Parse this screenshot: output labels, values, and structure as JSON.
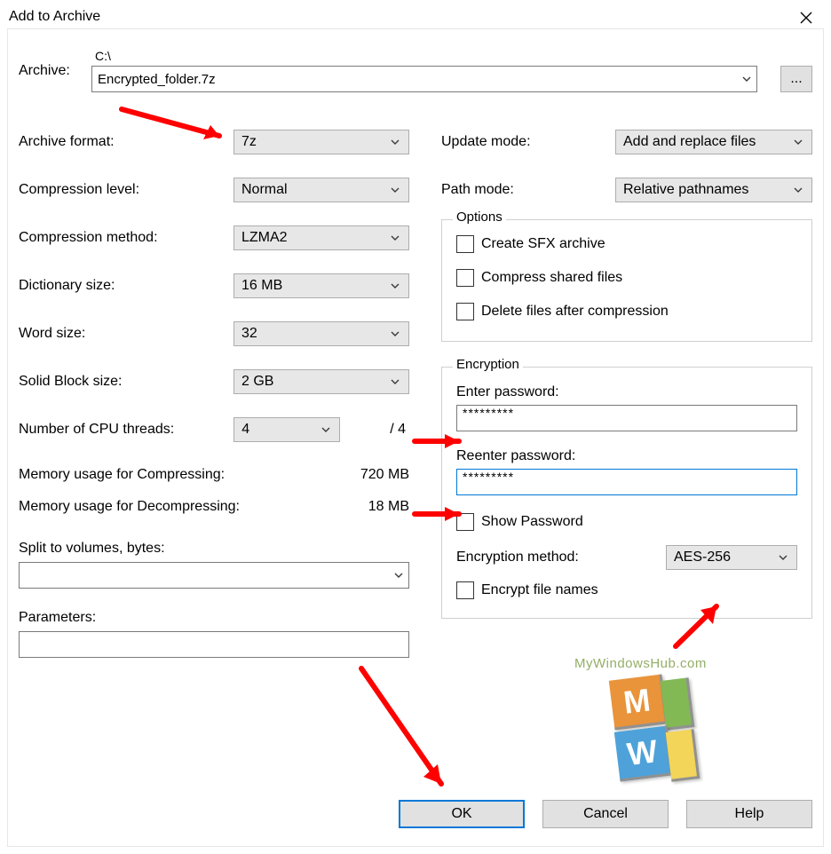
{
  "window": {
    "title": "Add to Archive"
  },
  "archive": {
    "label": "Archive:",
    "path": "C:\\",
    "filename": "Encrypted_folder.7z",
    "browse_label": "..."
  },
  "left": {
    "format_label": "Archive format:",
    "format_value": "7z",
    "level_label": "Compression level:",
    "level_value": "Normal",
    "method_label": "Compression method:",
    "method_value": "LZMA2",
    "dict_label": "Dictionary size:",
    "dict_value": "16 MB",
    "word_label": "Word size:",
    "word_value": "32",
    "solid_label": "Solid Block size:",
    "solid_value": "2 GB",
    "cpu_label": "Number of CPU threads:",
    "cpu_value": "4",
    "cpu_total": "/ 4",
    "mem_comp_label": "Memory usage for Compressing:",
    "mem_comp_value": "720 MB",
    "mem_decomp_label": "Memory usage for Decompressing:",
    "mem_decomp_value": "18 MB",
    "split_label": "Split to volumes, bytes:",
    "split_value": "",
    "params_label": "Parameters:",
    "params_value": ""
  },
  "right": {
    "update_label": "Update mode:",
    "update_value": "Add and replace files",
    "pathmode_label": "Path mode:",
    "pathmode_value": "Relative pathnames"
  },
  "options": {
    "legend": "Options",
    "sfx_label": "Create SFX archive",
    "shared_label": "Compress shared files",
    "delete_label": "Delete files after compression"
  },
  "encryption": {
    "legend": "Encryption",
    "enter_label": "Enter password:",
    "enter_value": "*********",
    "reenter_label": "Reenter password:",
    "reenter_value": "*********",
    "show_label": "Show Password",
    "method_label": "Encryption method:",
    "method_value": "AES-256",
    "names_label": "Encrypt file names"
  },
  "buttons": {
    "ok": "OK",
    "cancel": "Cancel",
    "help": "Help"
  },
  "watermark": {
    "text": "MyWindowsHub.com",
    "m": "M",
    "w": "W"
  }
}
